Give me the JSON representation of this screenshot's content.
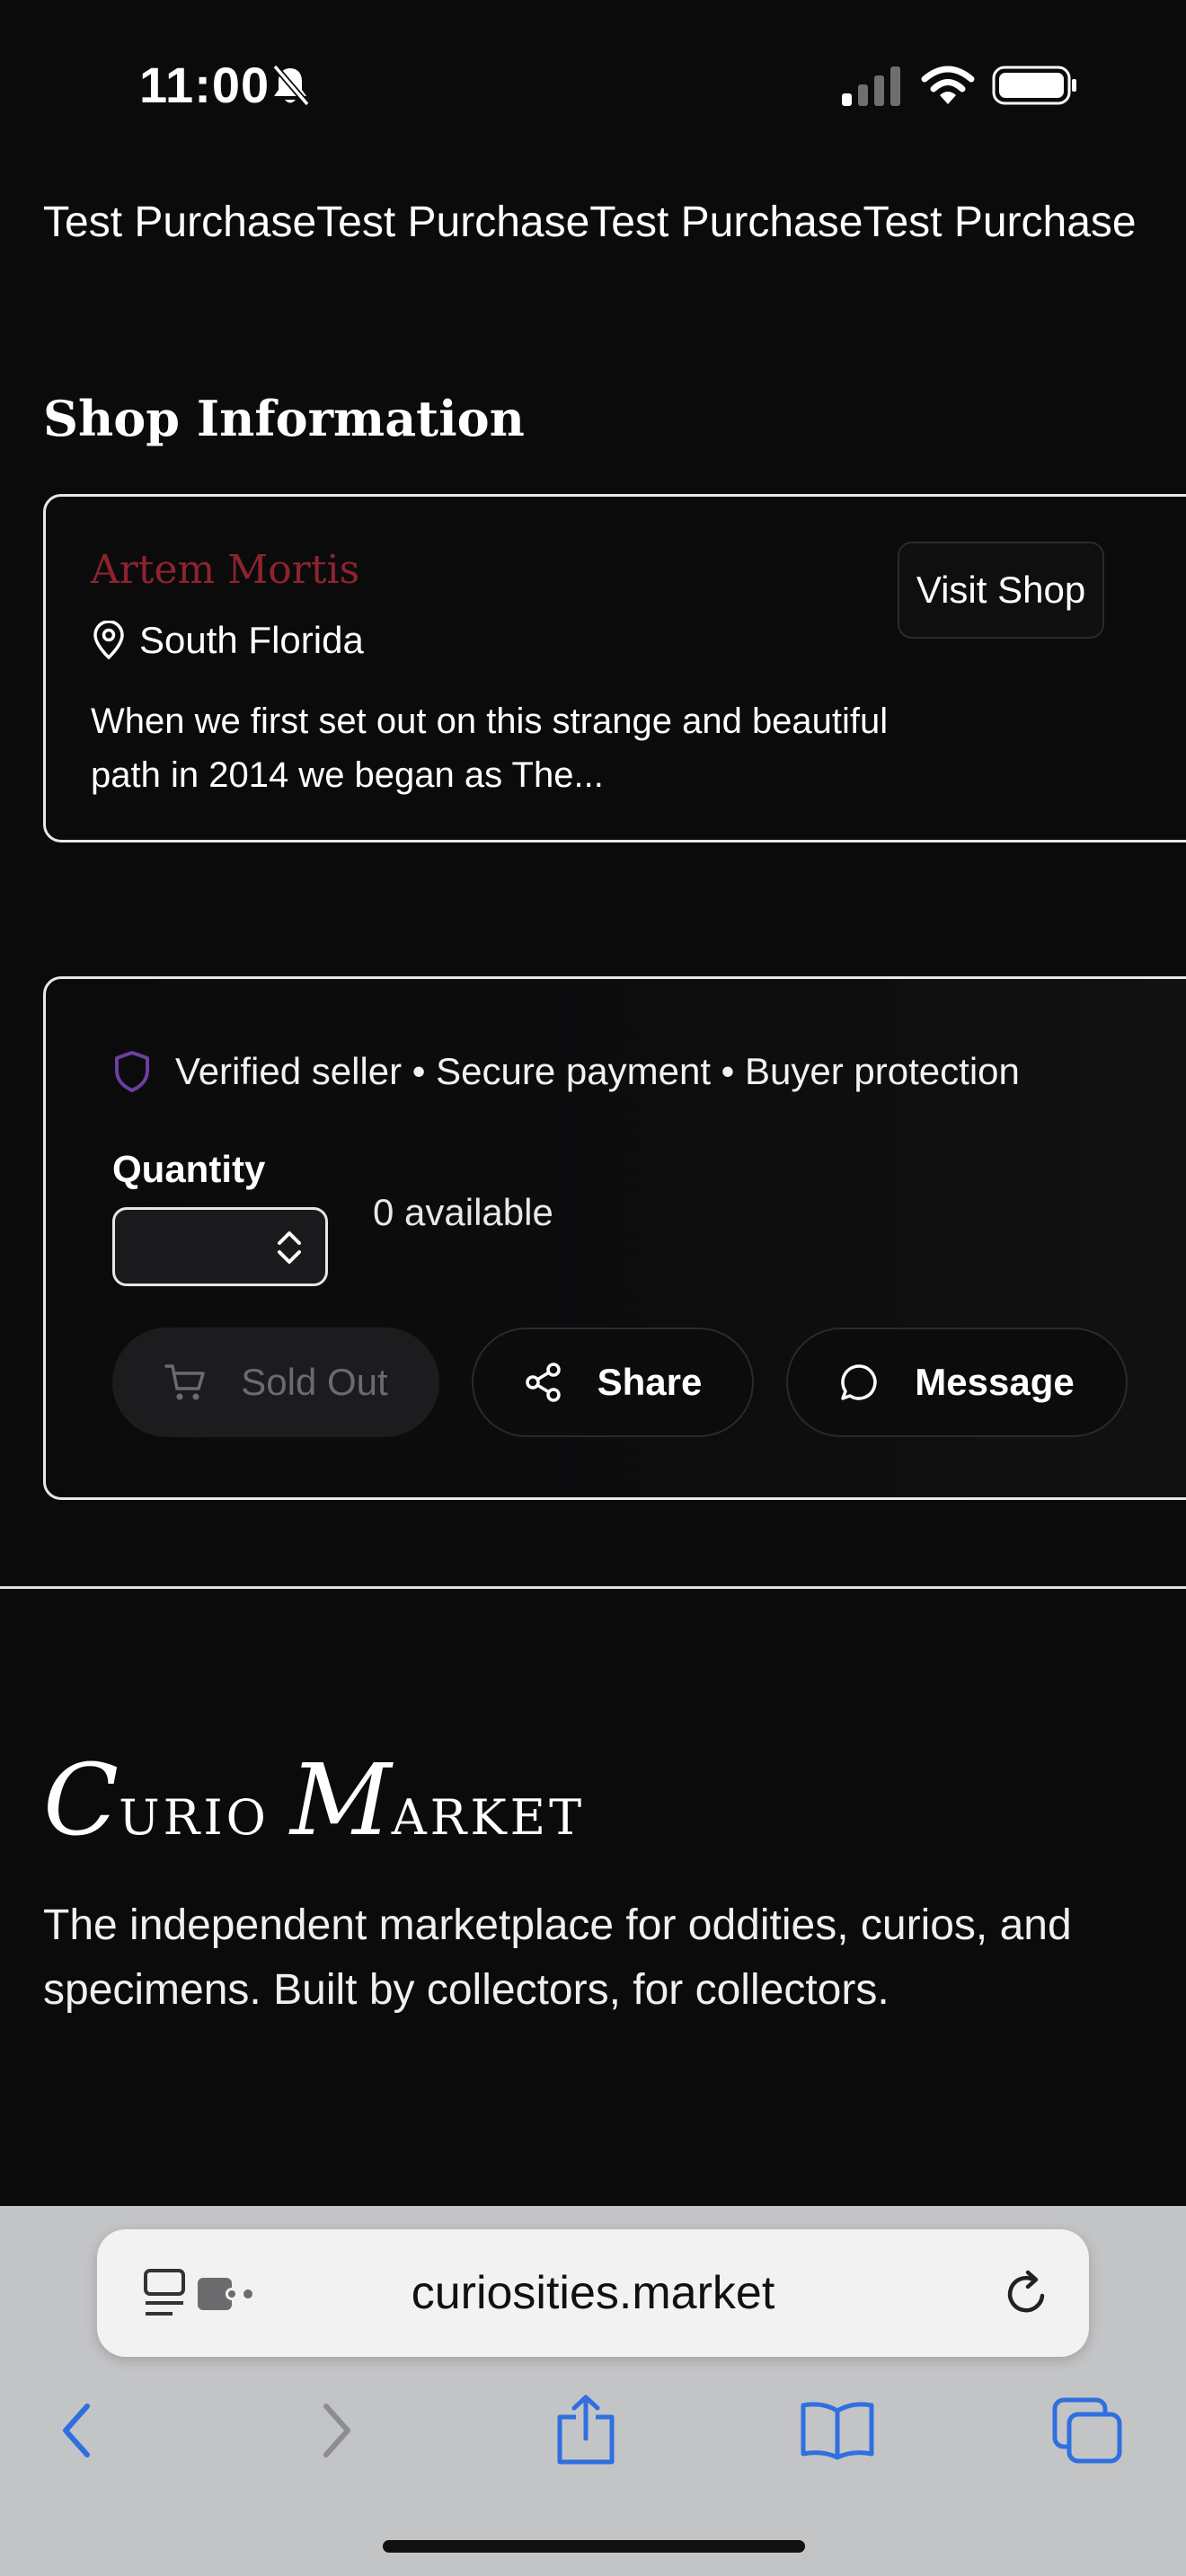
{
  "status_bar": {
    "time": "11:00",
    "icons": [
      "bell-slash-icon",
      "cellular-signal-icon",
      "wifi-icon",
      "battery-icon"
    ]
  },
  "product": {
    "title_repeat": "Test PurchaseTest PurchaseTest PurchaseTest Purchase"
  },
  "shop_section": {
    "heading": "Shop Information",
    "shop_name": "Artem Mortis",
    "location": "South Florida",
    "description": "When we first set out on this strange and beautiful path in 2014 we began as The...",
    "visit_button": "Visit Shop",
    "shop_name_color": "#8e2330"
  },
  "purchase": {
    "trust_text": "Verified seller • Secure payment • Buyer protection",
    "quantity_label": "Quantity",
    "available": "0 available",
    "sold_out_button": "Sold Out",
    "share_button": "Share",
    "message_button": "Message",
    "shield_color": "#6b3fa0"
  },
  "footer": {
    "brand_initial_1": "C",
    "brand_rest_1": "URIO",
    "brand_initial_2": "M",
    "brand_rest_2": "ARKET",
    "tagline": "The independent marketplace for oddities, curios, and specimens. Built by collectors, for collectors."
  },
  "browser": {
    "url": "curiosities.market",
    "accent_color": "#2f6fe0",
    "nav_icons": [
      "back-icon",
      "forward-icon",
      "share-icon",
      "bookmarks-icon",
      "tabs-icon"
    ]
  }
}
